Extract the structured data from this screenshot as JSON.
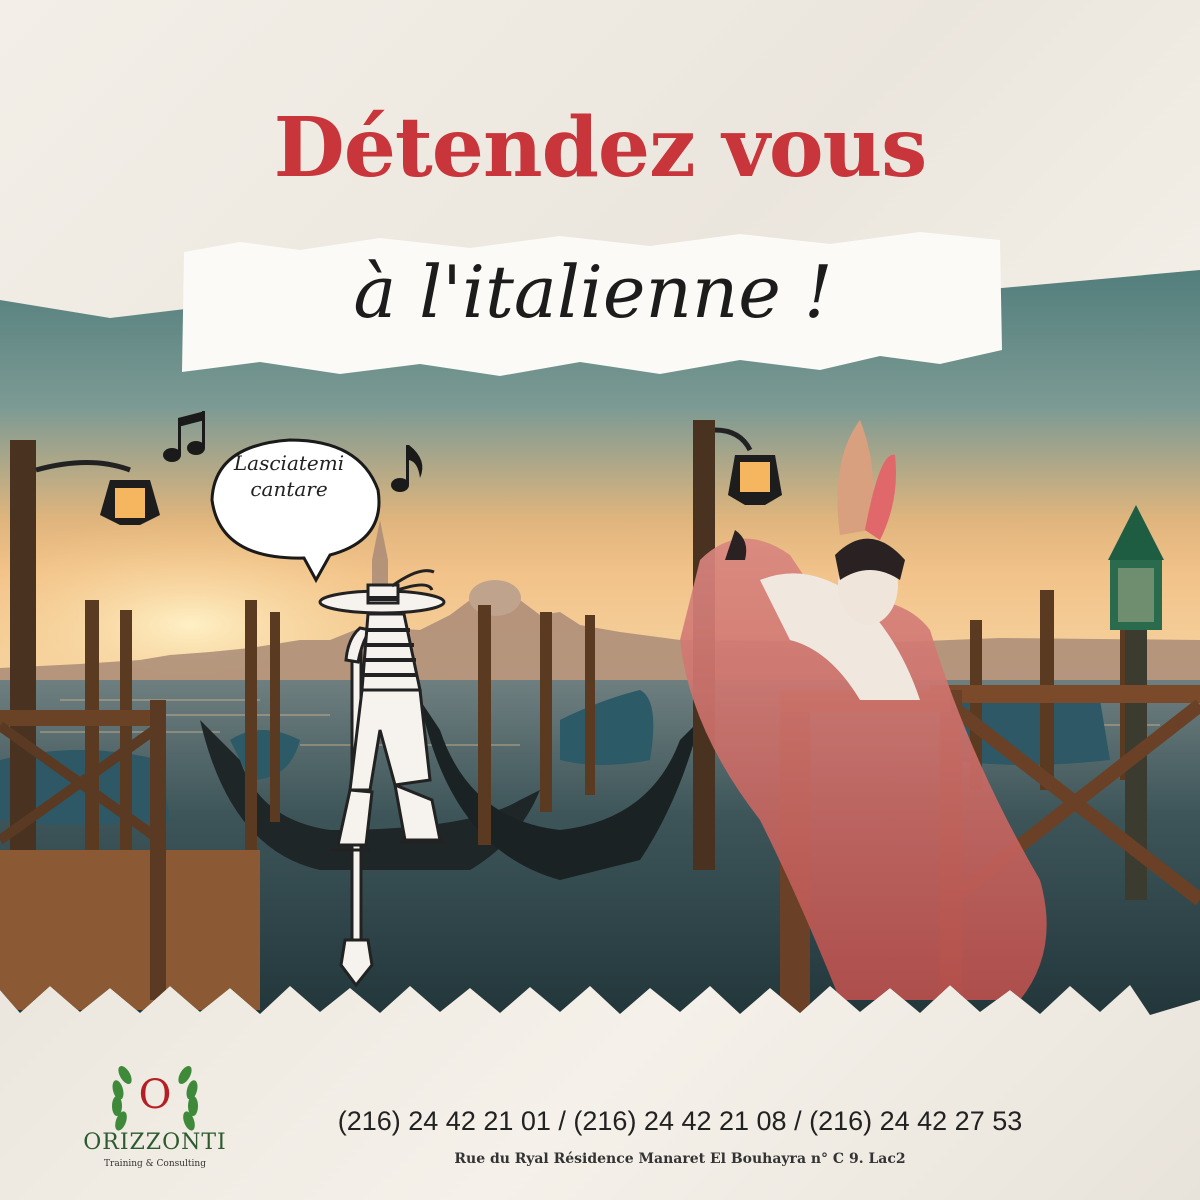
{
  "headline": {
    "line1": "Détendez vous",
    "line2": "à l'italienne !"
  },
  "speech_bubble": {
    "line1": "Lasciatemi",
    "line2": "cantare"
  },
  "brand": {
    "initial": "O",
    "name": "ORIZZONTI",
    "tagline": "Training & Consulting"
  },
  "contact": {
    "phones": "(216) 24 42 21 01 / (216) 24 42 21 08 / (216) 24 42 27 53",
    "address": "Rue du Ryal Résidence Manaret El Bouhayra n° C 9. Lac2"
  },
  "colors": {
    "headline_red": "#c8353a",
    "logo_red": "#b51f24",
    "logo_green": "#2b5b2f",
    "paper": "#f1ede6"
  },
  "icons": [
    "music-note-icon",
    "laurel-wreath-icon"
  ]
}
